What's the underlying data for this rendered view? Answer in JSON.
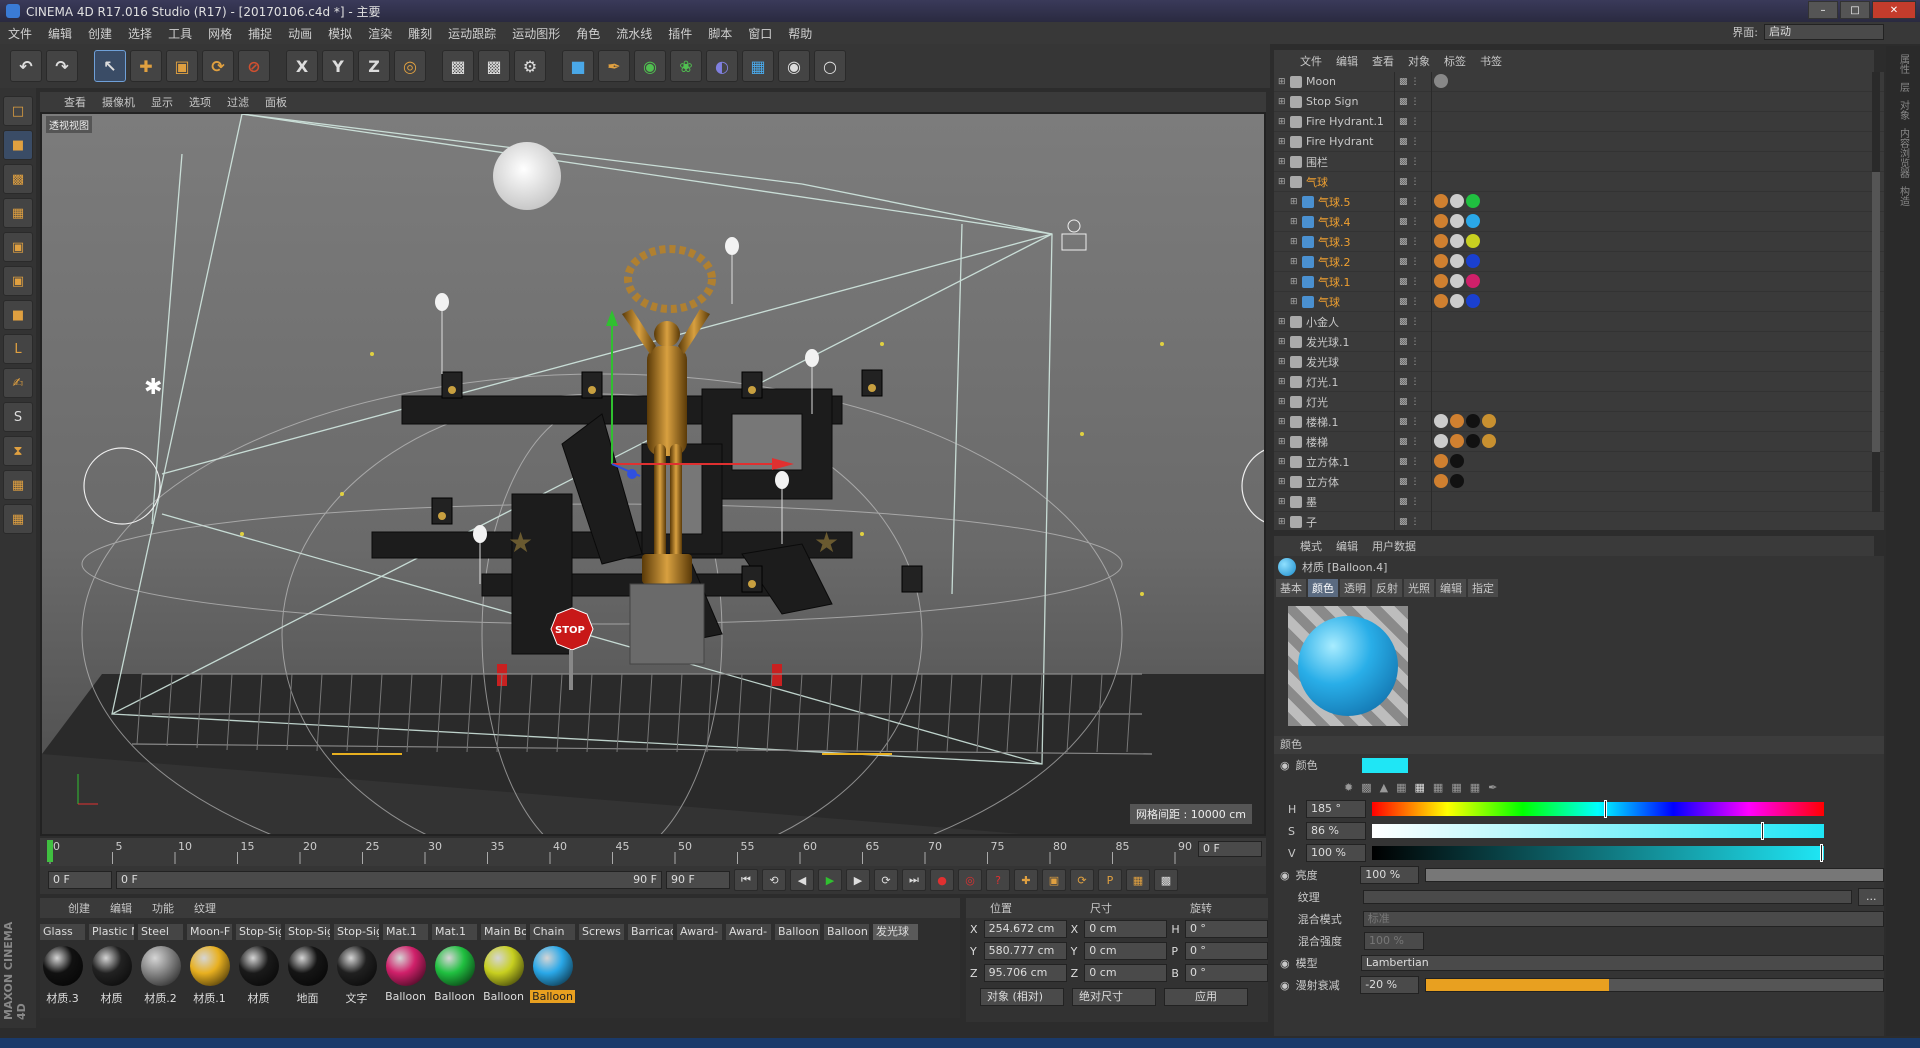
{
  "titlebar": {
    "title": "CINEMA 4D R17.016 Studio (R17) - [20170106.c4d *] - 主要"
  },
  "menubar": [
    "文件",
    "编辑",
    "创建",
    "选择",
    "工具",
    "网格",
    "捕捉",
    "动画",
    "模拟",
    "渲染",
    "雕刻",
    "运动跟踪",
    "运动图形",
    "角色",
    "流水线",
    "插件",
    "脚本",
    "窗口",
    "帮助"
  ],
  "layout": {
    "label": "界面:",
    "value": "启动"
  },
  "viewport": {
    "menu": [
      "查看",
      "摄像机",
      "显示",
      "选项",
      "过滤",
      "面板"
    ],
    "label": "透视视图",
    "grid_label": "网格间距 : 10000 cm",
    "scene_text": {
      "stop": "STOP"
    }
  },
  "timeline": {
    "ticks": [
      "0",
      "5",
      "10",
      "15",
      "20",
      "25",
      "30",
      "35",
      "40",
      "45",
      "50",
      "55",
      "60",
      "65",
      "70",
      "75",
      "80",
      "85",
      "90"
    ],
    "frame": "0 F",
    "start": "0 F",
    "range_start": "0 F",
    "range_end": "90 F",
    "end": "90 F"
  },
  "material_manager": {
    "menu": [
      "创建",
      "编辑",
      "功能",
      "纹理"
    ],
    "tags": [
      "Glass",
      "Plastic M",
      "Steel",
      "Moon-F",
      "Stop-Sig",
      "Stop-Sig",
      "Stop-Sig",
      "Mat.1",
      "Mat.1",
      "Main Bo",
      "Chain",
      "Screws",
      "Barricad",
      "Award-",
      "Award-",
      "Balloon",
      "Balloon",
      "发光球"
    ],
    "materials": [
      {
        "name": "材质.3",
        "color": "#111111"
      },
      {
        "name": "材质",
        "color": "#222222"
      },
      {
        "name": "材质.2",
        "color": "#888888"
      },
      {
        "name": "材质.1",
        "color": "#e8b020"
      },
      {
        "name": "材质",
        "color": "#1a1a1a"
      },
      {
        "name": "地面",
        "color": "#151515"
      },
      {
        "name": "文字",
        "color": "#202020"
      },
      {
        "name": "Balloon",
        "color": "#d0206a"
      },
      {
        "name": "Balloon",
        "color": "#20c040"
      },
      {
        "name": "Balloon",
        "color": "#c8d020"
      },
      {
        "name": "Balloon",
        "color": "#2aa8e8"
      }
    ]
  },
  "coordinates": {
    "headers": [
      "位置",
      "尺寸",
      "旋转"
    ],
    "rows": [
      {
        "pos_axis": "X",
        "pos": "254.672 cm",
        "size_axis": "X",
        "size": "0 cm",
        "rot_axis": "H",
        "rot": "0 °"
      },
      {
        "pos_axis": "Y",
        "pos": "580.777 cm",
        "size_axis": "Y",
        "size": "0 cm",
        "rot_axis": "P",
        "rot": "0 °"
      },
      {
        "pos_axis": "Z",
        "pos": "95.706 cm",
        "size_axis": "Z",
        "size": "0 cm",
        "rot_axis": "B",
        "rot": "0 °"
      }
    ],
    "mode": "对象 (相对)",
    "size_mode": "绝对尺寸",
    "apply": "应用"
  },
  "object_manager": {
    "menu": [
      "文件",
      "编辑",
      "查看",
      "对象",
      "标签",
      "书签"
    ],
    "objects": [
      {
        "name": "Moon",
        "depth": 0,
        "sel": false,
        "tags": [
          "#888888"
        ]
      },
      {
        "name": "Stop Sign",
        "depth": 0,
        "sel": false,
        "tags": []
      },
      {
        "name": "Fire Hydrant.1",
        "depth": 0,
        "sel": false,
        "tags": []
      },
      {
        "name": "Fire Hydrant",
        "depth": 0,
        "sel": false,
        "tags": []
      },
      {
        "name": "围栏",
        "depth": 0,
        "sel": false,
        "tags": []
      },
      {
        "name": "气球",
        "depth": 0,
        "sel": true,
        "tags": []
      },
      {
        "name": "气球.5",
        "depth": 1,
        "sel": true,
        "tags": [
          "#d08030",
          "#cccccc",
          "#20c040"
        ]
      },
      {
        "name": "气球.4",
        "depth": 1,
        "sel": true,
        "tags": [
          "#d08030",
          "#cccccc",
          "#2aa8e8"
        ]
      },
      {
        "name": "气球.3",
        "depth": 1,
        "sel": true,
        "tags": [
          "#d08030",
          "#cccccc",
          "#c8d020"
        ]
      },
      {
        "name": "气球.2",
        "depth": 1,
        "sel": true,
        "tags": [
          "#d08030",
          "#cccccc",
          "#1a40d0"
        ]
      },
      {
        "name": "气球.1",
        "depth": 1,
        "sel": true,
        "tags": [
          "#d08030",
          "#cccccc",
          "#d0206a"
        ]
      },
      {
        "name": "气球",
        "depth": 1,
        "sel": true,
        "tags": [
          "#d08030",
          "#cccccc",
          "#1a40d0"
        ]
      },
      {
        "name": "小金人",
        "depth": 0,
        "sel": false,
        "tags": []
      },
      {
        "name": "发光球.1",
        "depth": 0,
        "sel": false,
        "tags": []
      },
      {
        "name": "发光球",
        "depth": 0,
        "sel": false,
        "tags": []
      },
      {
        "name": "灯光.1",
        "depth": 0,
        "sel": false,
        "tags": []
      },
      {
        "name": "灯光",
        "depth": 0,
        "sel": false,
        "tags": []
      },
      {
        "name": "楼梯.1",
        "depth": 0,
        "sel": false,
        "tags": [
          "#cccccc",
          "#d08030",
          "#111111",
          "#c89030"
        ]
      },
      {
        "name": "楼梯",
        "depth": 0,
        "sel": false,
        "tags": [
          "#cccccc",
          "#d08030",
          "#111111",
          "#c89030"
        ]
      },
      {
        "name": "立方体.1",
        "depth": 0,
        "sel": false,
        "tags": [
          "#d08030",
          "#111111"
        ]
      },
      {
        "name": "立方体",
        "depth": 0,
        "sel": false,
        "tags": [
          "#d08030",
          "#111111"
        ]
      },
      {
        "name": "墨",
        "depth": 0,
        "sel": false,
        "tags": []
      },
      {
        "name": "子",
        "depth": 0,
        "sel": false,
        "tags": []
      }
    ]
  },
  "attributes": {
    "menu": [
      "模式",
      "编辑",
      "用户数据"
    ],
    "title": "材质 [Balloon.4]",
    "tabs": [
      "基本",
      "颜色",
      "透明",
      "反射",
      "光照",
      "编辑",
      "指定"
    ],
    "active_tab": "颜色",
    "section": "颜色",
    "color_label": "颜色",
    "color_value": "#1fe6f5",
    "h_label": "H",
    "h_value": "185 °",
    "h_fraction": 0.514,
    "s_label": "S",
    "s_value": "86 %",
    "s_fraction": 0.86,
    "v_label": "V",
    "v_value": "100 %",
    "v_fraction": 1.0,
    "brightness_label": "亮度",
    "brightness_value": "100 %",
    "brightness_fraction": 1.0,
    "texture_label": "纹理",
    "blend_mode_label": "混合模式",
    "blend_mode_value": "标准",
    "blend_strength_label": "混合强度",
    "blend_strength_value": "100 %",
    "model_label": "模型",
    "model_value": "Lambertian",
    "diffuse_label": "漫射衰减",
    "diffuse_value": "-20 %",
    "diffuse_fraction": 0.4
  },
  "rightstrip": [
    "属性",
    "层",
    "对象",
    "内容浏览器",
    "构造"
  ],
  "status": "MAXON CINEMA 4D"
}
